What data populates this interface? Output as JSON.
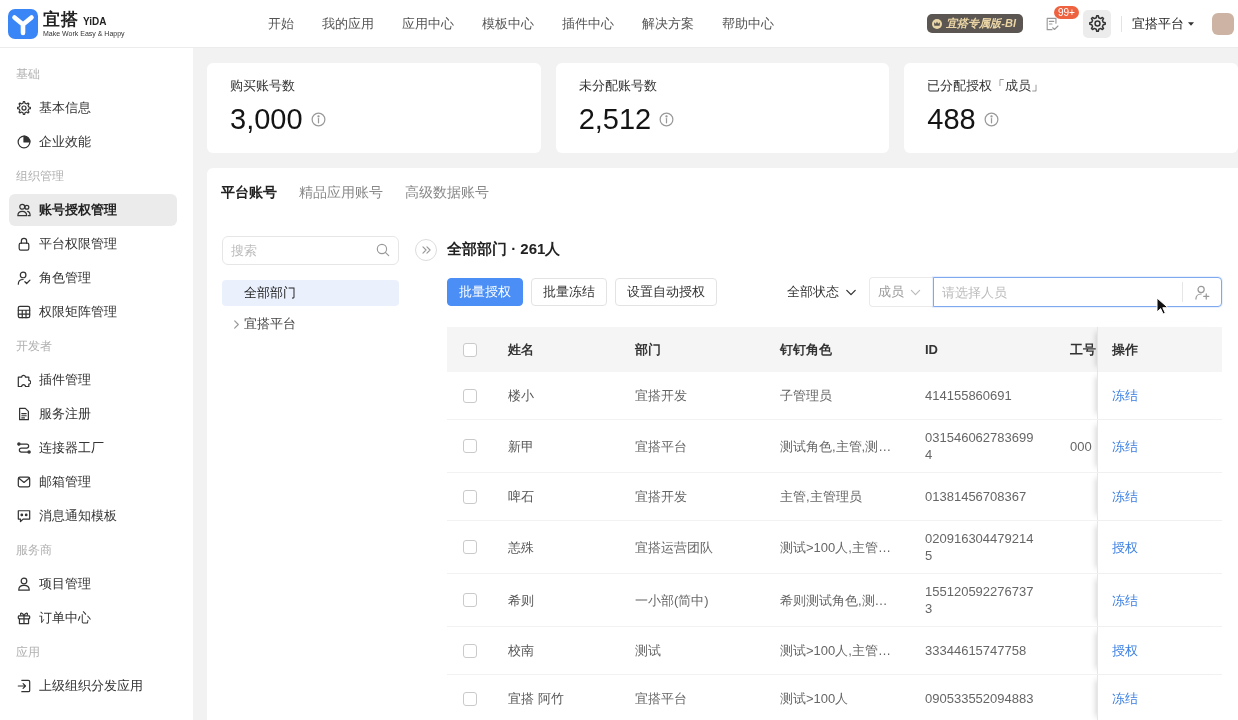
{
  "header": {
    "logo": {
      "name": "宜搭",
      "latin": "YiDA",
      "slogan": "Make Work Easy & Happy"
    },
    "nav": [
      {
        "label": "开始",
        "selected": false
      },
      {
        "label": "我的应用",
        "selected": false
      },
      {
        "label": "应用中心",
        "selected": false
      },
      {
        "label": "模板中心",
        "selected": false
      },
      {
        "label": "插件中心",
        "selected": false
      },
      {
        "label": "解决方案",
        "selected": false
      },
      {
        "label": "帮助中心",
        "selected": false
      }
    ],
    "edition_badge": "宜搭专属版-BI",
    "notification_count": "99+",
    "organization": "宜搭平台"
  },
  "sidebar": {
    "sections": [
      {
        "title": "基础",
        "items": [
          {
            "label": "基本信息",
            "selected": false
          },
          {
            "label": "企业效能",
            "selected": false
          }
        ]
      },
      {
        "title": "组织管理",
        "items": [
          {
            "label": "账号授权管理",
            "selected": true
          },
          {
            "label": "平台权限管理",
            "selected": false
          },
          {
            "label": "角色管理",
            "selected": false
          },
          {
            "label": "权限矩阵管理",
            "selected": false
          }
        ]
      },
      {
        "title": "开发者",
        "items": [
          {
            "label": "插件管理",
            "selected": false
          },
          {
            "label": "服务注册",
            "selected": false
          },
          {
            "label": "连接器工厂",
            "selected": false
          },
          {
            "label": "邮箱管理",
            "selected": false
          },
          {
            "label": "消息通知模板",
            "selected": false
          }
        ]
      },
      {
        "title": "服务商",
        "items": [
          {
            "label": "项目管理",
            "selected": false
          },
          {
            "label": "订单中心",
            "selected": false
          }
        ]
      },
      {
        "title": "应用",
        "items": [
          {
            "label": "上级组织分发应用",
            "selected": false
          }
        ]
      }
    ]
  },
  "stats": [
    {
      "label": "购买账号数",
      "value": "3,000"
    },
    {
      "label": "未分配账号数",
      "value": "2,512"
    },
    {
      "label": "已分配授权「成员」",
      "value": "488"
    }
  ],
  "tabs": [
    {
      "label": "平台账号",
      "selected": true
    },
    {
      "label": "精品应用账号",
      "selected": false
    },
    {
      "label": "高级数据账号",
      "selected": false
    }
  ],
  "department_tree": {
    "search": {
      "placeholder": "搜索"
    },
    "nodes": [
      {
        "label": "全部部门",
        "selected": true
      },
      {
        "label": "宜搭平台",
        "selected": false,
        "expanded": false
      }
    ]
  },
  "content": {
    "heading": "全部部门 · 261人",
    "actions": [
      {
        "label": "批量授权",
        "kind": "primary"
      },
      {
        "label": "批量冻结",
        "kind": "default"
      },
      {
        "label": "设置自动授权",
        "kind": "default"
      }
    ],
    "status_filter": "全部状态",
    "member_picker": {
      "type": "成员",
      "placeholder": "请选择人员",
      "focused": true
    }
  },
  "table": {
    "select_all": {
      "checked": false
    },
    "columns": [
      "姓名",
      "部门",
      "钉钉角色",
      "ID",
      "工号",
      "操作"
    ],
    "rows": [
      {
        "checked": false,
        "name": "楼小",
        "department": "宜搭开发",
        "role": "子管理员",
        "id": "414155860691",
        "action": "冻结"
      },
      {
        "checked": false,
        "name": "新甲",
        "department": "宜搭平台",
        "role": "测试角色,主管,测…",
        "id": "0315460627836994",
        "employee_no": "000",
        "action": "冻结"
      },
      {
        "checked": false,
        "name": "啤石",
        "department": "宜搭开发",
        "role": "主管,主管理员",
        "id": "01381456708367",
        "action": "冻结"
      },
      {
        "checked": false,
        "name": "恙殊",
        "department": "宜搭运营团队",
        "role": "测试>100人,主管…",
        "id": "0209163044792145",
        "action": "授权"
      },
      {
        "checked": false,
        "name": "希则",
        "department": "一小部(简中)",
        "role": "希则测试角色,测…",
        "id": "1551205922767373",
        "action": "冻结"
      },
      {
        "checked": false,
        "name": "校南",
        "department": "测试",
        "role": "测试>100人,主管…",
        "id": "33344615747758",
        "action": "授权"
      },
      {
        "checked": false,
        "name": "宜搭 阿竹",
        "department": "宜搭平台",
        "role": "测试>100人",
        "id": "090533552094883",
        "action": "冻结"
      }
    ]
  }
}
